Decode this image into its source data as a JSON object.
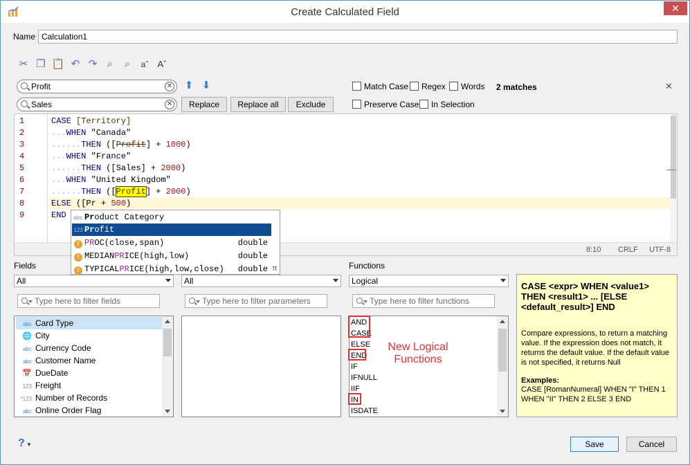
{
  "window": {
    "title": "Create Calculated Field",
    "close": "✕"
  },
  "name_label": "Name",
  "name_value": "Calculation1",
  "find": {
    "find_value": "Profit",
    "replace_value": "Sales",
    "replace_button": "Replace",
    "replace_all_button": "Replace all",
    "exclude_button": "Exclude",
    "match_case": "Match Case",
    "regex": "Regex",
    "words": "Words",
    "preserve_case": "Preserve Case",
    "in_selection": "In Selection",
    "matches": "2 matches",
    "close": "✕"
  },
  "editor": {
    "line_numbers": [
      "1",
      "2",
      "3",
      "4",
      "5",
      "6",
      "7",
      "8",
      "9"
    ],
    "position": "8:10",
    "eol": "CRLF",
    "encoding": "UTF-8",
    "code": {
      "l1_kw": "CASE",
      "l1_fld": "[Territory]",
      "l2_dots": "...",
      "l2_kw": "WHEN",
      "l2_str": "\"Canada\"",
      "l3_dots": "......",
      "l3_kw": "THEN",
      "l3_open": "([",
      "l3_fld": "Profit",
      "l3_close": "] +",
      "l3_num": "1000",
      "l3_end": ")",
      "l4_dots": "...",
      "l4_kw": "WHEN",
      "l4_str": "\"France\"",
      "l5_dots": "......",
      "l5_kw": "THEN",
      "l5_rest": "([Sales] +",
      "l5_num": "2000",
      "l5_end": ")",
      "l6_dots": "...",
      "l6_kw": "WHEN",
      "l6_str": "\"United Kingdom\"",
      "l7_dots": "......",
      "l7_kw": "THEN",
      "l7_open": "([",
      "l7_fld": "Profit",
      "l7_close": "] +",
      "l7_num": "2000",
      "l7_end": ")",
      "l8_kw": "ELSE",
      "l8_rest": "([Pr",
      "l8_plus": "+",
      "l8_num": "500",
      "l8_end": ")",
      "l9_kw": "END"
    }
  },
  "autocomplete": [
    {
      "icon": "abc",
      "match": "Pr",
      "rest": "oduct Category",
      "ret": ""
    },
    {
      "icon": "123",
      "match": "Pr",
      "rest": "ofit",
      "ret": ""
    },
    {
      "icon": "f",
      "pre": "",
      "match": "PR",
      "rest": "OC(close,span)",
      "ret": "double"
    },
    {
      "icon": "f",
      "pre": "MEDIAN",
      "match": "PR",
      "rest": "ICE(high,low)",
      "ret": "double"
    },
    {
      "icon": "f",
      "pre": "TYPICAL",
      "match": "PR",
      "rest": "ICE(high,low,close)",
      "ret": "double"
    }
  ],
  "fields_panel": {
    "label": "Fields",
    "combo": "All",
    "filter_placeholder": "Type here to filter fields",
    "items": [
      {
        "icon": "abc",
        "name": "Card Type"
      },
      {
        "icon": "globe",
        "name": "City"
      },
      {
        "icon": "abc",
        "name": "Currency Code"
      },
      {
        "icon": "abc",
        "name": "Customer Name"
      },
      {
        "icon": "date",
        "name": "DueDate"
      },
      {
        "icon": "123",
        "name": "Freight"
      },
      {
        "icon": "*123",
        "name": "Number of Records"
      },
      {
        "icon": "abc",
        "name": "Online Order Flag"
      }
    ]
  },
  "params_panel": {
    "combo": "All",
    "filter_placeholder": "Type here to filter parameters"
  },
  "functions_panel": {
    "label": "Functions",
    "combo": "Logical",
    "filter_placeholder": "Type here to filter functions",
    "items": [
      "AND",
      "CASE",
      "ELSE",
      "END",
      "IF",
      "IFNULL",
      "IIF",
      "IN",
      "ISDATE"
    ],
    "annotation": "New Logical Functions"
  },
  "help": {
    "signature": "CASE <expr> WHEN <value1> THEN <result1> ... [ELSE <default_result>] END",
    "description": "Compare expressions, to return a matching value. If the expression does not match, it returns the default value. If the default value is not specified, it returns Null",
    "examples_heading": "Examples:",
    "example": "CASE [RomanNumeral] WHEN \"I\" THEN 1 WHEN \"II\" THEN 2 ELSE 3 END"
  },
  "footer": {
    "help_icon": "?",
    "save": "Save",
    "cancel": "Cancel"
  }
}
